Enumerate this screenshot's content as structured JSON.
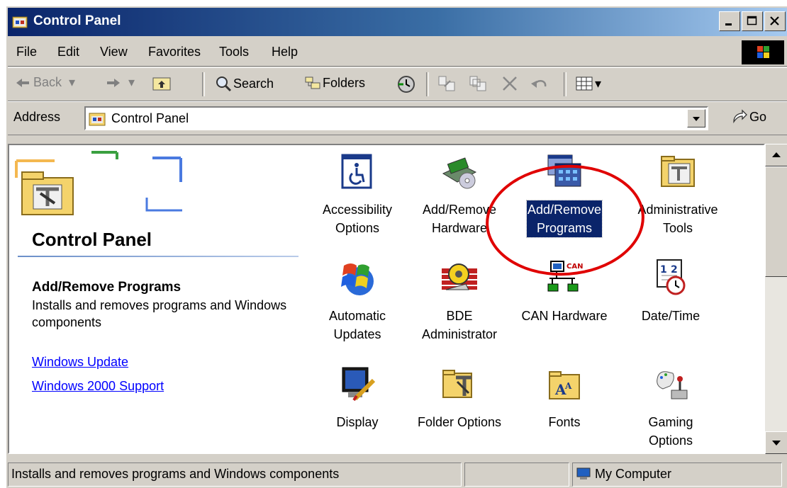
{
  "window": {
    "title": "Control Panel"
  },
  "menu": [
    "File",
    "Edit",
    "View",
    "Favorites",
    "Tools",
    "Help"
  ],
  "toolbar": {
    "back": "Back",
    "search": "Search",
    "folders": "Folders"
  },
  "address": {
    "label": "Address",
    "value": "Control Panel",
    "go": "Go"
  },
  "left_panel": {
    "title": "Control Panel",
    "heading": "Add/Remove Programs",
    "description": "Installs and removes programs and Windows components",
    "links": [
      "Windows Update",
      "Windows 2000 Support"
    ]
  },
  "items": [
    {
      "line1": "Accessibility",
      "line2": "Options",
      "icon": "accessibility-icon"
    },
    {
      "line1": "Add/Remove",
      "line2": "Hardware",
      "icon": "hardware-icon"
    },
    {
      "line1": "Add/Remove",
      "line2": "Programs",
      "icon": "programs-icon",
      "selected": true
    },
    {
      "line1": "Administrative",
      "line2": "Tools",
      "icon": "admin-tools-icon"
    },
    {
      "line1": "Automatic",
      "line2": "Updates",
      "icon": "windows-update-icon"
    },
    {
      "line1": "BDE",
      "line2": "Administrator",
      "icon": "bde-icon"
    },
    {
      "line1": "CAN Hardware",
      "line2": "",
      "icon": "can-network-icon"
    },
    {
      "line1": "Date/Time",
      "line2": "",
      "icon": "calendar-clock-icon"
    },
    {
      "line1": "Display",
      "line2": "",
      "icon": "display-icon"
    },
    {
      "line1": "Folder Options",
      "line2": "",
      "icon": "folder-options-icon"
    },
    {
      "line1": "Fonts",
      "line2": "",
      "icon": "fonts-folder-icon"
    },
    {
      "line1": "Gaming",
      "line2": "Options",
      "icon": "joystick-icon"
    }
  ],
  "status": {
    "text": "Installs and removes programs and Windows components",
    "zone": "My Computer"
  },
  "colors": {
    "titlebar": "#0a246a",
    "selection": "#0a246a",
    "highlight_circle": "#e00000",
    "link": "#0000ff"
  }
}
